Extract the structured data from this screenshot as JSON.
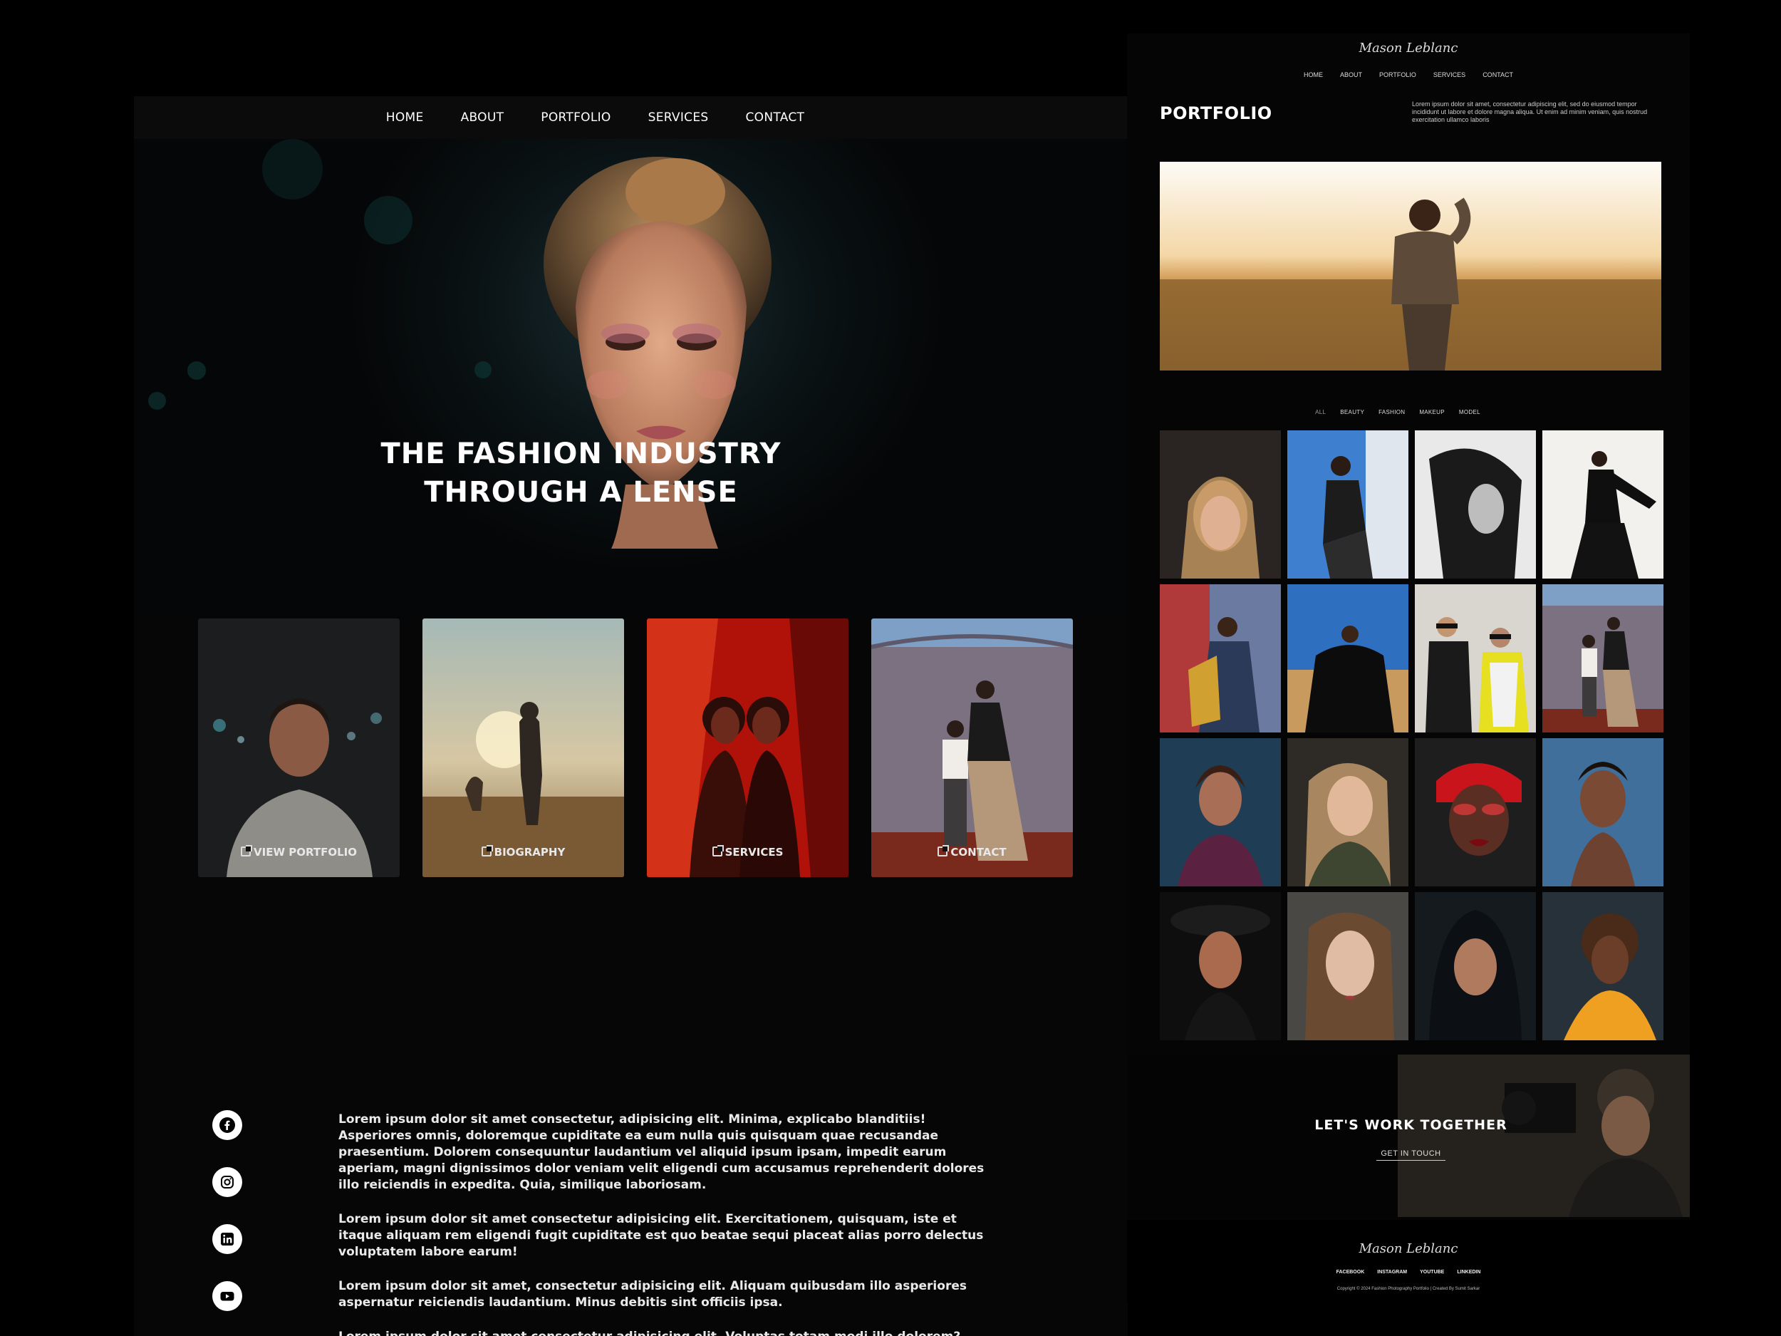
{
  "left": {
    "nav": [
      "HOME",
      "ABOUT",
      "PORTFOLIO",
      "SERVICES",
      "CONTACT"
    ],
    "hero_title_line1": "THE FASHION INDUSTRY",
    "hero_title_line2": "THROUGH A LENSE",
    "cards": [
      {
        "label": "VIEW PORTFOLIO",
        "icon": "external-link-icon"
      },
      {
        "label": "BIOGRAPHY",
        "icon": "external-link-icon"
      },
      {
        "label": "SERVICES",
        "icon": "external-link-icon"
      },
      {
        "label": "CONTACT",
        "icon": "external-link-icon"
      }
    ],
    "socials": [
      "facebook-icon",
      "instagram-icon",
      "linkedin-icon",
      "youtube-icon"
    ],
    "bio": [
      "Lorem ipsum dolor sit amet consectetur, adipisicing elit. Minima, explicabo blanditiis! Asperiores omnis, doloremque cupiditate ea eum nulla quis quisquam quae recusandae praesentium. Dolorem consequuntur laudantium vel aliquid ipsum ipsam, impedit earum aperiam, magni dignissimos dolor veniam velit eligendi cum accusamus reprehenderit dolores illo reiciendis in expedita. Quia, similique laboriosam.",
      "Lorem ipsum dolor sit amet consectetur adipisicing elit. Exercitationem, quisquam, iste et itaque aliquam rem eligendi fugit cupiditate est quo beatae sequi placeat alias porro delectus voluptatem labore earum!",
      "Lorem ipsum dolor sit amet, consectetur adipisicing elit. Aliquam quibusdam illo asperiores aspernatur reiciendis laudantium. Minus debitis sint officiis ipsa.",
      "Lorem ipsum dolor sit amet consectetur adipisicing elit. Voluptas totam modi illo dolorem? Ratione fugit velit cum accusantium nobis exercitationem eveniet minima perferendis sequi dolore, provident rerum placeat blanditiis itaque"
    ]
  },
  "right": {
    "logo": "Mason Leblanc",
    "nav": [
      "HOME",
      "ABOUT",
      "PORTFOLIO",
      "SERVICES",
      "CONTACT"
    ],
    "title": "PORTFOLIO",
    "intro": "Lorem ipsum dolor sit amet, consectetur adipiscing elit, sed do eiusmod tempor incididunt ut labore et dolore magna aliqua. Ut enim ad minim veniam, quis nostrud exercitation ullamco laboris",
    "filters": [
      "ALL",
      "BEAUTY",
      "FASHION",
      "MAKEUP",
      "MODEL"
    ],
    "cta_title": "LET'S WORK TOGETHER",
    "cta_link": "GET IN TOUCH",
    "footer_logo": "Mason Leblanc",
    "footer_links": [
      "FACEBOOK",
      "INSTAGRAM",
      "YOUTUBE",
      "LINKEDIN"
    ],
    "copyright": "Copyright © 2024 Fashion Photography Portfolio | Created By Sumit Sarkar"
  },
  "colors": {
    "background": "#000000",
    "panel": "#060606",
    "text": "#ffffff",
    "accent_red": "#b0120a"
  }
}
